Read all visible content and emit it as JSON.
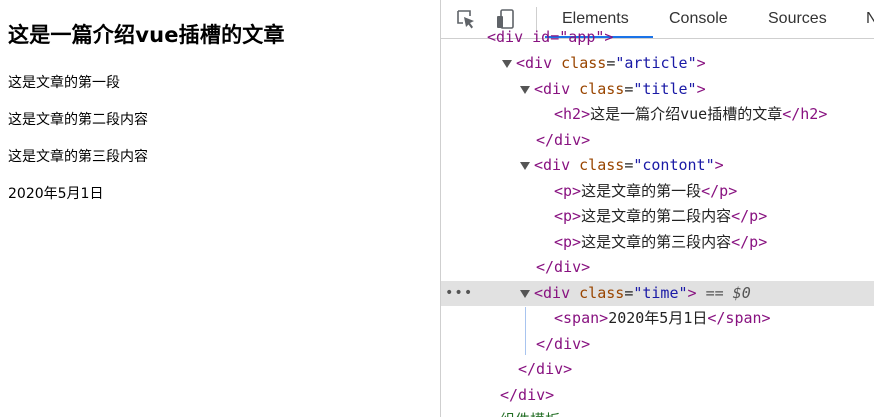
{
  "page": {
    "heading": "这是一篇介绍vue插槽的文章",
    "paragraphs": [
      "这是文章的第一段",
      "这是文章的第二段内容",
      "这是文章的第三段内容"
    ],
    "date": "2020年5月1日"
  },
  "devtools": {
    "tabs": [
      "Elements",
      "Console",
      "Sources",
      "N"
    ],
    "active_tab": "Elements",
    "icons": [
      "inspect-element-icon",
      "device-toolbar-icon"
    ],
    "selected_suffix": "== $0",
    "tree": {
      "partial_top": "<div id=\"app\">",
      "div_article_open": {
        "tag": "div",
        "attr": "class",
        "val": "article"
      },
      "div_title_open": {
        "tag": "div",
        "attr": "class",
        "val": "title"
      },
      "h2_text": "这是一篇介绍vue插槽的文章",
      "div_contont_open": {
        "tag": "div",
        "attr": "class",
        "val": "contont"
      },
      "p_texts": [
        "这是文章的第一段",
        "这是文章的第二段内容",
        "这是文章的第三段内容"
      ],
      "div_time_open": {
        "tag": "div",
        "attr": "class",
        "val": "time"
      },
      "span_text": "2020年5月1日",
      "partial_bottom": "组件模板"
    }
  }
}
